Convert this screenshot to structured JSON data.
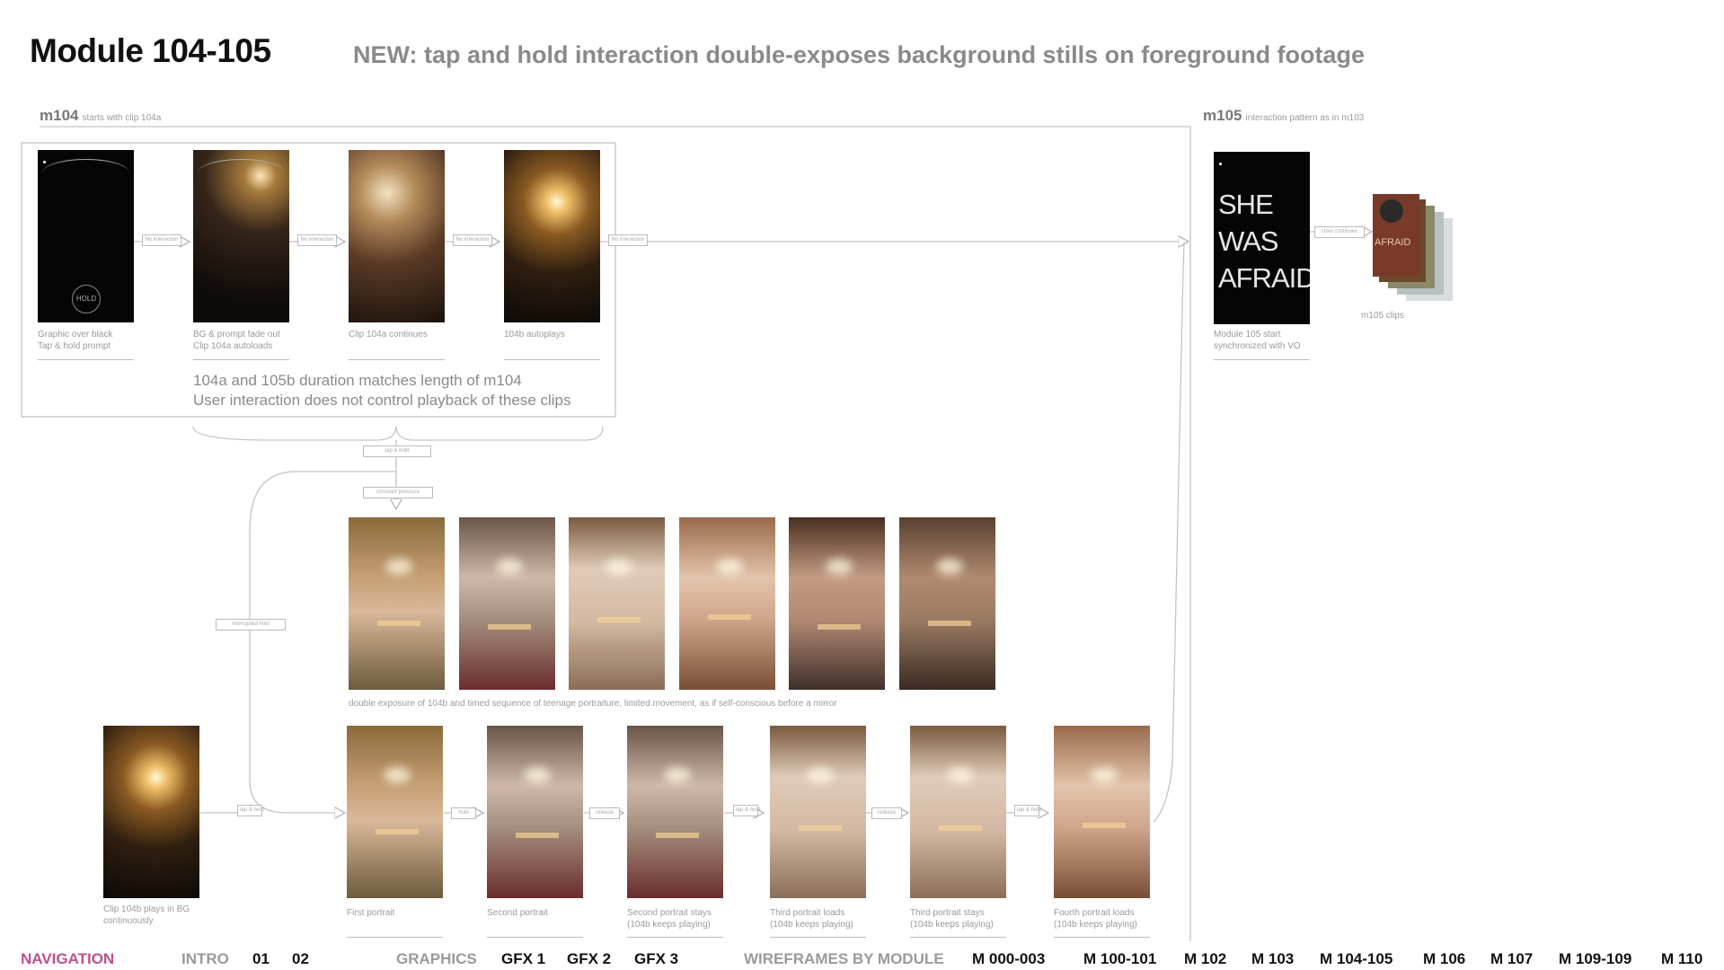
{
  "header": {
    "title": "Module 104-105",
    "subtitle": "NEW: tap and hold interaction double-exposes background stills on foreground footage"
  },
  "sections": {
    "m104": {
      "label": "m104",
      "note": "starts with clip 104a"
    },
    "m105": {
      "label": "m105",
      "note": "interaction pattern as in m103"
    }
  },
  "m104_row": [
    {
      "caption_line1": "Graphic over black",
      "caption_line2": "Tap & hold prompt",
      "hold_label": "HOLD"
    },
    {
      "caption_line1": "BG & prompt fade out",
      "caption_line2": "Clip 104a autoloads"
    },
    {
      "caption_line1": "Clip 104a continues",
      "caption_line2": ""
    },
    {
      "caption_line1": "104b autoplays",
      "caption_line2": ""
    }
  ],
  "m104_note": {
    "line1": "104a and 105b duration matches length of m104",
    "line2": "User interaction does not control playback of these clips"
  },
  "m105": {
    "she_text": [
      "SHE",
      "WAS",
      "AFRAID"
    ],
    "stack_text": "AFRAID",
    "caption_line1": "Module 105 start",
    "caption_line2": "synchronized with VO",
    "clips_caption": "m105 clips"
  },
  "stills_caption": "double exposure of 104b and timed sequence of teenage portraiture, limited movement, as if self-conscious before a mirror",
  "bottom_row": [
    {
      "caption_line1": "Clip 104b plays in BG",
      "caption_line2": "continuously"
    },
    {
      "caption_line1": "First portrait",
      "caption_line2": ""
    },
    {
      "caption_line1": "Second portrait",
      "caption_line2": ""
    },
    {
      "caption_line1": "Second portrait stays",
      "caption_line2": "(104b keeps playing)"
    },
    {
      "caption_line1": "Third portrait loads",
      "caption_line2": "(104b keeps playing)"
    },
    {
      "caption_line1": "Third portrait stays",
      "caption_line2": "(104b keeps playing)"
    },
    {
      "caption_line1": "Fourth portrait loads",
      "caption_line2": "(104b keeps playing)"
    }
  ],
  "connector_tags": {
    "no_interaction": "No interaction",
    "user_continues": "User continues",
    "tap_hold": "tap & hold",
    "constant_pressure": "constant pressure",
    "interrupted_hold": "interrupted hold",
    "tap_and_hold": "tap & hold",
    "hold": "hold",
    "release": "release"
  },
  "navigation": {
    "heading": "NAVIGATION",
    "intro": {
      "label": "INTRO",
      "links": [
        "01",
        "02"
      ]
    },
    "graphics": {
      "label": "GRAPHICS",
      "links": [
        "GFX 1",
        "GFX 2",
        "GFX 3"
      ]
    },
    "wireframes": {
      "label": "WIREFRAMES BY MODULE",
      "links": [
        "M 000-003",
        "M 100-101",
        "M 102",
        "M 103",
        "M 104-105",
        "M 106",
        "M 107",
        "M 109-109",
        "M 110"
      ]
    }
  },
  "colors": {
    "nav_heading": "#c0508a",
    "connector": "#b5b5b5",
    "muted_text": "#9a9a9a"
  }
}
